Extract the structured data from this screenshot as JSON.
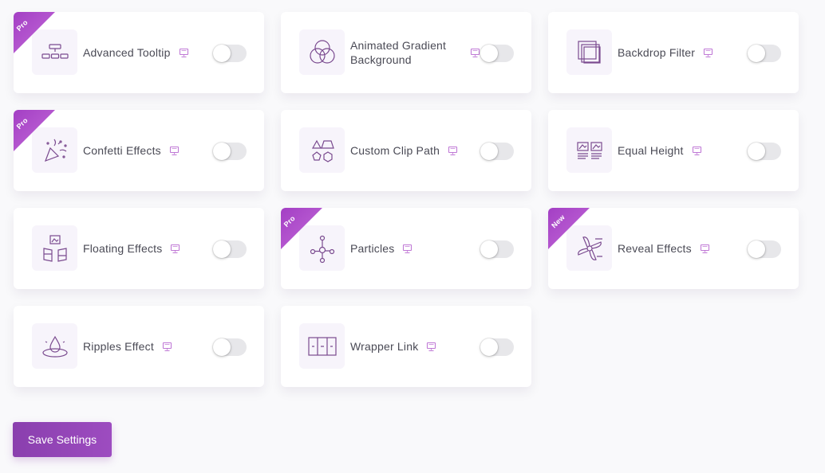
{
  "widgets": [
    {
      "name": "Advanced Tooltip",
      "badge": "Pro",
      "icon": "tooltip-icon",
      "enabled": false
    },
    {
      "name": "Animated Gradient Background",
      "badge": "",
      "icon": "gradient-circles-icon",
      "enabled": false
    },
    {
      "name": "Backdrop Filter",
      "badge": "",
      "icon": "layers-icon",
      "enabled": false
    },
    {
      "name": "Confetti Effects",
      "badge": "Pro",
      "icon": "party-popper-icon",
      "enabled": false
    },
    {
      "name": "Custom Clip Path",
      "badge": "",
      "icon": "shapes-icon",
      "enabled": false
    },
    {
      "name": "Equal Height",
      "badge": "",
      "icon": "equal-columns-icon",
      "enabled": false
    },
    {
      "name": "Floating Effects",
      "badge": "",
      "icon": "floating-panels-icon",
      "enabled": false
    },
    {
      "name": "Particles",
      "badge": "Pro",
      "icon": "particles-icon",
      "enabled": false
    },
    {
      "name": "Reveal Effects",
      "badge": "New",
      "icon": "reveal-icon",
      "enabled": false
    },
    {
      "name": "Ripples Effect",
      "badge": "",
      "icon": "ripple-drop-icon",
      "enabled": false
    },
    {
      "name": "Wrapper Link",
      "badge": "",
      "icon": "wrapper-link-icon",
      "enabled": false
    }
  ],
  "demo_icon": "monitor-icon",
  "colors": {
    "accent": "#8e44ad",
    "icon_stroke": "#7a4a8f",
    "demo_icon": "#c07ad6",
    "toggle_off": "#e7e7ea"
  },
  "footer": {
    "save_label": "Save Settings"
  }
}
